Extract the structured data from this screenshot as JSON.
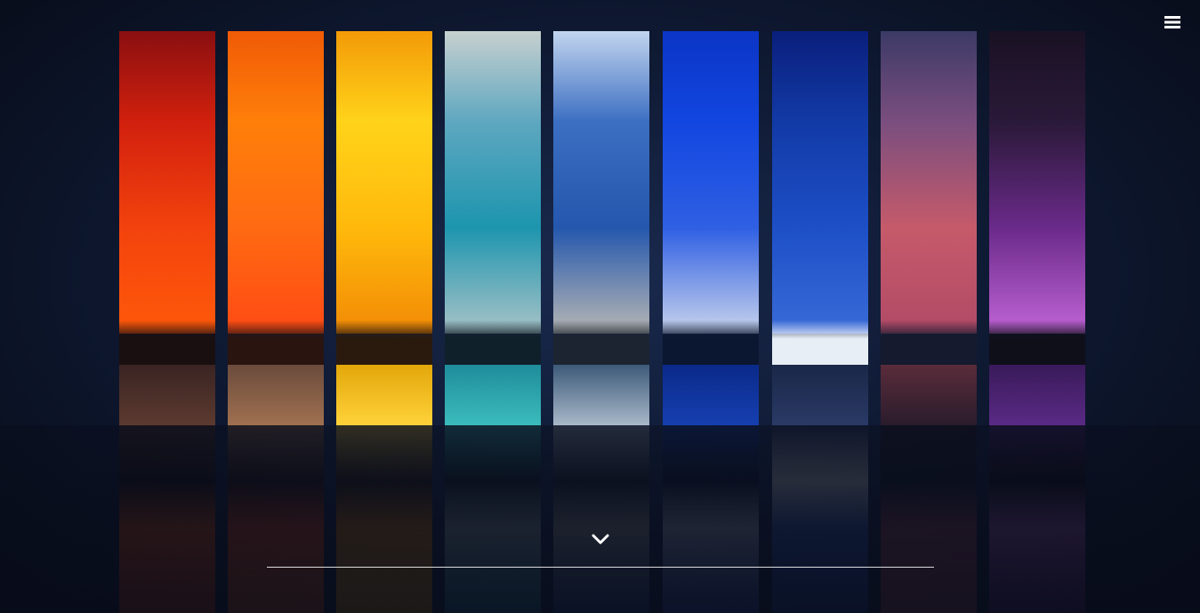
{
  "header": {
    "menu_icon": "hamburger-menu-icon"
  },
  "hero": {
    "image_description": "",
    "scroll_icon": "chevron-down-icon",
    "strips": [
      {
        "name": "red",
        "sky": [
          "#8a0f10",
          "#d1200e",
          "#f3420d",
          "#ff5a0a"
        ],
        "land": "#1a0f10",
        "sea": [
          "#3a2422",
          "#5c3a30"
        ]
      },
      {
        "name": "orange",
        "sky": [
          "#f05a06",
          "#ff7f0a",
          "#ff6a12",
          "#ff4a14"
        ],
        "land": "#2a1410",
        "sea": [
          "#6b4b3c",
          "#a07050"
        ]
      },
      {
        "name": "yellow",
        "sky": [
          "#f39a07",
          "#ffd31a",
          "#ffb90b",
          "#f28a06"
        ],
        "land": "#2a1a0e",
        "sea": [
          "#e2a70a",
          "#ffd23a"
        ]
      },
      {
        "name": "teal",
        "sky": [
          "#c7d0cf",
          "#5ea7c0",
          "#1d95ae",
          "#a9c3c8"
        ],
        "land": "#10202a",
        "sea": [
          "#1f8c9b",
          "#3bbcbc"
        ]
      },
      {
        "name": "sky-blue",
        "sky": [
          "#c2d5ee",
          "#3c6fc2",
          "#2457ad",
          "#b8b7b4"
        ],
        "land": "#1b2430",
        "sea": [
          "#3d5a7a",
          "#a8b8c8"
        ]
      },
      {
        "name": "blue",
        "sky": [
          "#0b35c5",
          "#1246e0",
          "#2f5fe3",
          "#c9d4ec"
        ],
        "land": "#0b1630",
        "sea": [
          "#0a2a8a",
          "#163fb0"
        ]
      },
      {
        "name": "indigo",
        "sky": [
          "#0a1f7c",
          "#123aa6",
          "#1d4fc7",
          "#3a6bd8"
        ],
        "land": "#e8eef6",
        "sea": [
          "#1a2748",
          "#2a3a66"
        ]
      },
      {
        "name": "violet",
        "sky": [
          "#3c3a66",
          "#7a4e7f",
          "#c55a6a",
          "#b14a66"
        ],
        "land": "#151a2e",
        "sea": [
          "#5a2c3a",
          "#2a1c2c"
        ]
      },
      {
        "name": "purple",
        "sky": [
          "#1a1124",
          "#2a1938",
          "#6a2a8a",
          "#c064d6"
        ],
        "land": "#0f0f1a",
        "sea": [
          "#3a1a5a",
          "#5a2a86"
        ]
      }
    ]
  }
}
